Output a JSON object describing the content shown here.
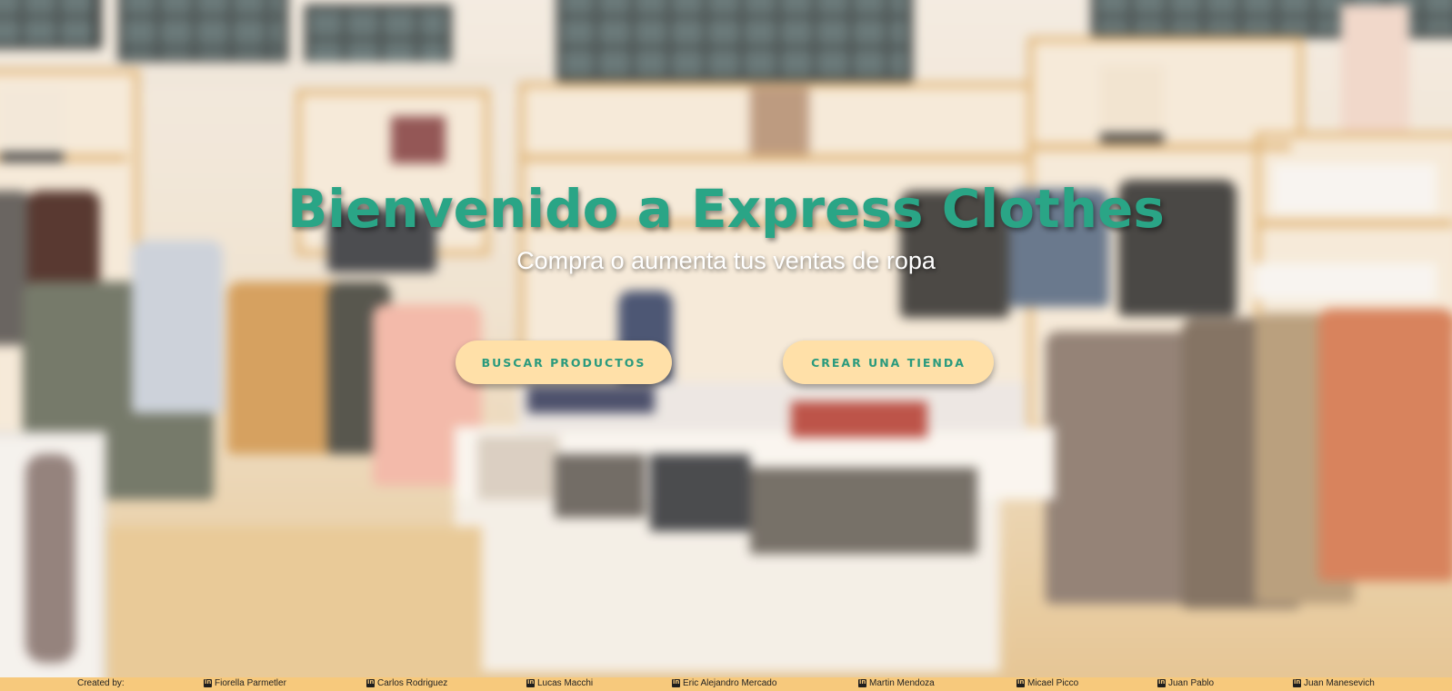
{
  "hero": {
    "title": "Bienvenido a Express Clothes",
    "subtitle": "Compra o aumenta tus ventas de ropa",
    "buttons": [
      {
        "label": "BUSCAR PRODUCTOS"
      },
      {
        "label": "CREAR UNA TIENDA"
      }
    ]
  },
  "footer": {
    "created_by_label": "Created by:",
    "credits": [
      {
        "name": "Fiorella Parmetler",
        "icon": "linkedin-icon"
      },
      {
        "name": "Carlos Rodriguez",
        "icon": "linkedin-icon"
      },
      {
        "name": "Lucas Macchi",
        "icon": "linkedin-icon"
      },
      {
        "name": "Eric Alejandro Mercado",
        "icon": "linkedin-icon"
      },
      {
        "name": "Martin Mendoza",
        "icon": "linkedin-icon"
      },
      {
        "name": "Micael Picco",
        "icon": "linkedin-icon"
      },
      {
        "name": "Juan Pablo",
        "icon": "linkedin-icon"
      },
      {
        "name": "Juan Manesevich",
        "icon": "linkedin-icon"
      }
    ]
  },
  "colors": {
    "title_green": "#2aa586",
    "button_bg": "#ffe0a8",
    "button_text": "#2a9a7d",
    "footer_bg": "#f7c97c"
  }
}
